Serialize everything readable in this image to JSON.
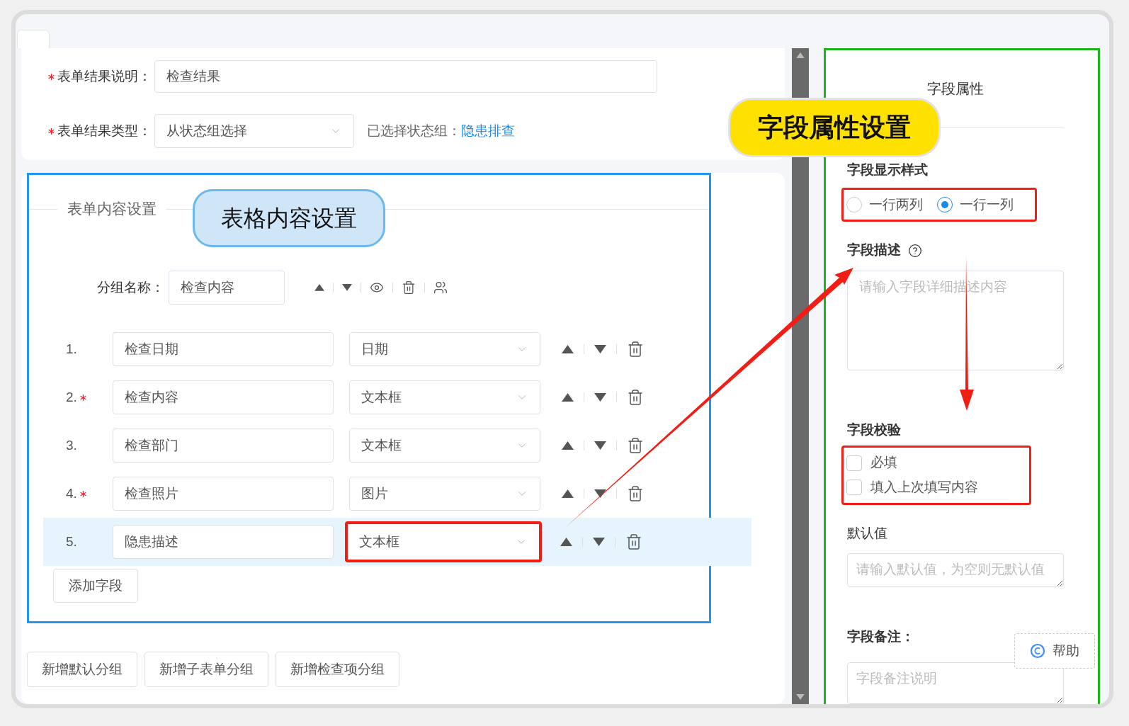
{
  "top_form": {
    "result_description": {
      "label": "表单结果说明：",
      "required": true,
      "value": "检查结果"
    },
    "result_type": {
      "label": "表单结果类型：",
      "required": true,
      "value": "从状态组选择"
    },
    "selected_group": {
      "label": "已选择状态组：",
      "link": "隐患排查"
    }
  },
  "content_section": {
    "title": "表单内容设置",
    "callout": "表格内容设置",
    "group": {
      "label": "分组名称：",
      "value": "检查内容"
    },
    "fields": [
      {
        "number": "1.",
        "required": false,
        "name": "检查日期",
        "type": "日期",
        "selected": false
      },
      {
        "number": "2.",
        "required": true,
        "name": "检查内容",
        "type": "文本框",
        "selected": false
      },
      {
        "number": "3.",
        "required": false,
        "name": "检查部门",
        "type": "文本框",
        "selected": false
      },
      {
        "number": "4.",
        "required": true,
        "name": "检查照片",
        "type": "图片",
        "selected": false
      },
      {
        "number": "5.",
        "required": false,
        "name": "隐患描述",
        "type": "文本框",
        "selected": true
      }
    ],
    "add_button": "添加字段"
  },
  "bottom_buttons": [
    "新增默认分组",
    "新增子表单分组",
    "新增检查项分组"
  ],
  "properties_panel": {
    "title": "字段属性",
    "callout": "字段属性设置",
    "display_style": {
      "label": "字段显示样式",
      "options": [
        {
          "label": "一行两列",
          "selected": false
        },
        {
          "label": "一行一列",
          "selected": true
        }
      ]
    },
    "description": {
      "label": "字段描述",
      "placeholder": "请输入字段详细描述内容"
    },
    "validation": {
      "label": "字段校验",
      "options": [
        {
          "label": "必填",
          "checked": false
        },
        {
          "label": "填入上次填写内容",
          "checked": false
        }
      ]
    },
    "default_value": {
      "label": "默认值",
      "placeholder": "请输入默认值，为空则无默认值"
    },
    "remark": {
      "label": "字段备注：",
      "placeholder": "字段备注说明"
    }
  },
  "help_button": "帮助"
}
